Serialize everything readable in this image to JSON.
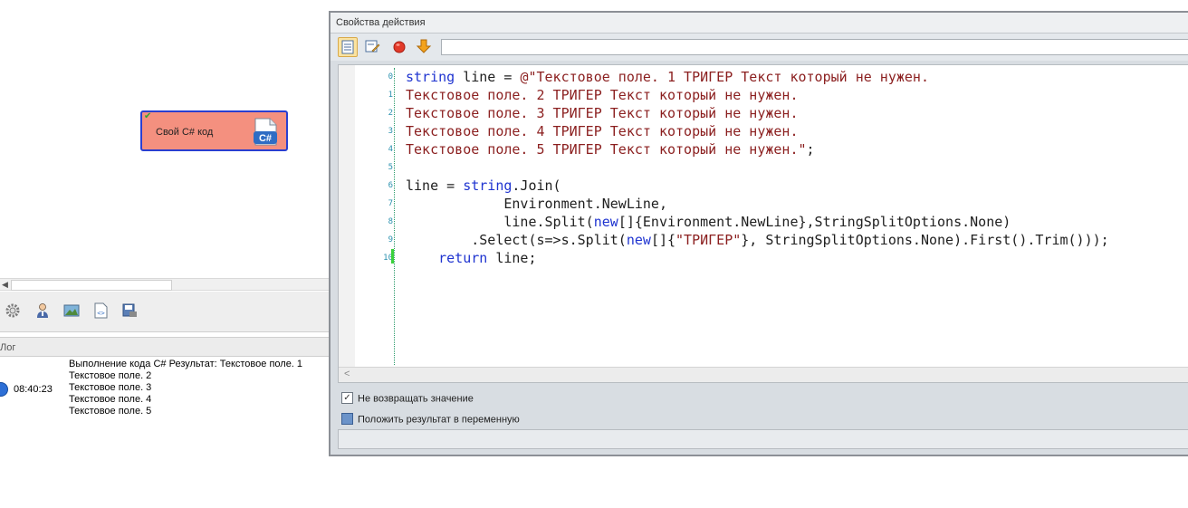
{
  "node": {
    "label": "Свой C# код",
    "icon": "csharp-file-icon",
    "status_icon": "checkmark-icon",
    "badge_text": "C#"
  },
  "left_toolbar": {
    "icons": [
      "gear-icon",
      "user-icon",
      "image-icon",
      "script-icon",
      "save-icon"
    ]
  },
  "log": {
    "title": "Лог",
    "time": "08:40:23",
    "message_lines": [
      "Выполнение кода C#  Результат: Текстовое поле. 1",
      "Текстовое поле. 2",
      "Текстовое поле. 3",
      "Текстовое поле. 4",
      "Текстовое поле. 5"
    ]
  },
  "dialog": {
    "title": "Свойства действия",
    "toolbar_icons": [
      "list-icon",
      "edit-icon",
      "stop-icon",
      "down-arrow-icon"
    ],
    "toolbar_input_value": "",
    "code_lines": [
      [
        [
          "kw",
          "string"
        ],
        [
          "pl",
          " line = "
        ],
        [
          "st",
          "@\"Текстовое поле. 1 ТРИГЕР Текст который не нужен."
        ]
      ],
      [
        [
          "st",
          "Текстовое поле. 2 ТРИГЕР Текст который не нужен."
        ]
      ],
      [
        [
          "st",
          "Текстовое поле. 3 ТРИГЕР Текст который не нужен."
        ]
      ],
      [
        [
          "st",
          "Текстовое поле. 4 ТРИГЕР Текст который не нужен."
        ]
      ],
      [
        [
          "st",
          "Текстовое поле. 5 ТРИГЕР Текст который не нужен.\""
        ],
        [
          "pl",
          ";"
        ]
      ],
      [],
      [
        [
          "pl",
          "line = "
        ],
        [
          "kw",
          "string"
        ],
        [
          "pl",
          ".Join("
        ]
      ],
      [
        [
          "pl",
          "            Environment.NewLine,"
        ]
      ],
      [
        [
          "pl",
          "            line.Split("
        ],
        [
          "kw",
          "new"
        ],
        [
          "pl",
          "[]{Environment.NewLine},StringSplitOptions.None)"
        ]
      ],
      [
        [
          "pl",
          "        .Select(s=>s.Split("
        ],
        [
          "kw",
          "new"
        ],
        [
          "pl",
          "[]{"
        ],
        [
          "st",
          "\"ТРИГЕР\""
        ],
        [
          "pl",
          "}, StringSplitOptions.None).First().Trim()));"
        ]
      ],
      [
        [
          "kw",
          "    return"
        ],
        [
          "pl",
          " line;"
        ]
      ]
    ],
    "line_numbers": [
      "0",
      "1",
      "2",
      "3",
      "4",
      "5",
      "6",
      "7",
      "8",
      "9",
      "10"
    ],
    "hscroll_arrow": "<",
    "option_no_return": {
      "label": "Не возвращать значение",
      "checked": true
    },
    "option_put_var": {
      "label": "Положить результат в переменную",
      "checked": false
    },
    "result_value": ""
  },
  "colors": {
    "keyword": "#1f34d0",
    "string": "#8b1f1f",
    "node_fill": "#f4907f",
    "node_border": "#2a3fd0",
    "line_number": "#2b91af"
  }
}
